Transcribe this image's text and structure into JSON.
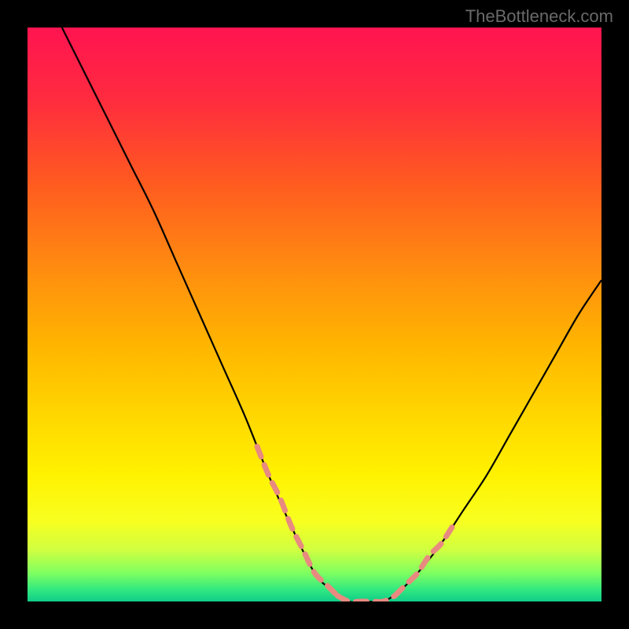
{
  "watermark": "TheBottleneck.com",
  "gradient": {
    "stops": [
      {
        "offset": 0.0,
        "color": "#ff1450"
      },
      {
        "offset": 0.12,
        "color": "#ff2a40"
      },
      {
        "offset": 0.27,
        "color": "#ff5a20"
      },
      {
        "offset": 0.42,
        "color": "#ff8c10"
      },
      {
        "offset": 0.55,
        "color": "#ffb400"
      },
      {
        "offset": 0.68,
        "color": "#ffd800"
      },
      {
        "offset": 0.78,
        "color": "#fff200"
      },
      {
        "offset": 0.86,
        "color": "#f8ff20"
      },
      {
        "offset": 0.91,
        "color": "#d0ff40"
      },
      {
        "offset": 0.95,
        "color": "#80ff60"
      },
      {
        "offset": 0.98,
        "color": "#30e880"
      },
      {
        "offset": 1.0,
        "color": "#10cc88"
      }
    ]
  },
  "chart_data": {
    "type": "line",
    "title": "",
    "xlabel": "",
    "ylabel": "",
    "xlim": [
      0,
      100
    ],
    "ylim": [
      0,
      100
    ],
    "series": [
      {
        "name": "curve",
        "color": "#000000",
        "x": [
          6,
          10,
          14,
          18,
          22,
          26,
          30,
          34,
          38,
          42,
          46,
          50,
          53,
          56,
          59,
          62,
          65,
          68,
          72,
          76,
          80,
          84,
          88,
          92,
          96,
          100
        ],
        "y": [
          100,
          92,
          84,
          76,
          68,
          59,
          50,
          41,
          32,
          22,
          13,
          5,
          2,
          0,
          0,
          0,
          2,
          5,
          10,
          16,
          22,
          29,
          36,
          43,
          50,
          56
        ]
      },
      {
        "name": "highlight-left",
        "color": "#e88a80",
        "style": "dashed",
        "x": [
          40,
          42,
          44,
          46,
          48,
          50,
          52,
          54
        ],
        "y": [
          27,
          22,
          18,
          13,
          9,
          5,
          3,
          1
        ]
      },
      {
        "name": "highlight-bottom",
        "color": "#e88a80",
        "style": "dashed",
        "x": [
          54,
          56,
          58,
          60,
          62,
          64
        ],
        "y": [
          1,
          0,
          0,
          0,
          0,
          1
        ]
      },
      {
        "name": "highlight-right",
        "color": "#e88a80",
        "style": "dashed",
        "x": [
          64,
          66,
          68,
          70,
          72,
          74
        ],
        "y": [
          1,
          3,
          5,
          8,
          10,
          13
        ]
      }
    ]
  }
}
